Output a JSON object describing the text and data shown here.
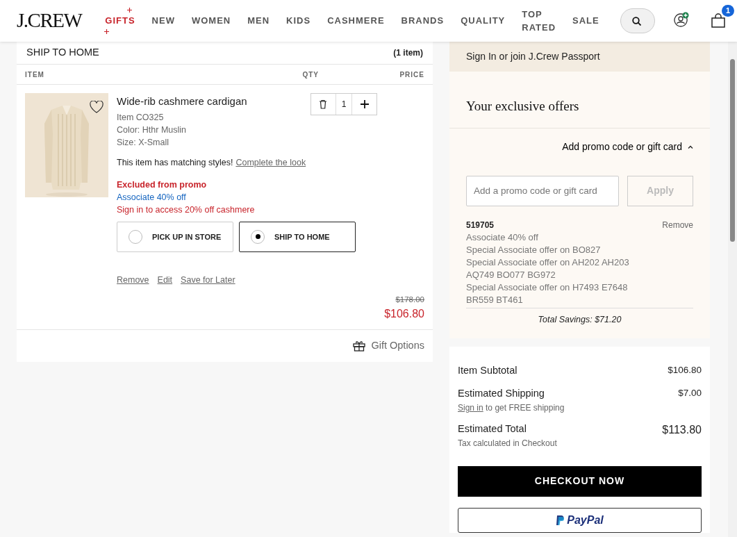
{
  "header": {
    "logo": "J.CREW",
    "cart_count": "1",
    "nav": [
      {
        "label": "GIFTS",
        "kind": "featured"
      },
      {
        "label": "NEW",
        "kind": "plain"
      },
      {
        "label": "WOMEN",
        "kind": "plain"
      },
      {
        "label": "MEN",
        "kind": "plain"
      },
      {
        "label": "KIDS",
        "kind": "plain"
      },
      {
        "label": "CASHMERE",
        "kind": "plain"
      },
      {
        "label": "BRANDS",
        "kind": "plain"
      },
      {
        "label": "QUALITY",
        "kind": "plain"
      },
      {
        "label": "TOP RATED",
        "kind": "plain"
      },
      {
        "label": "SALE",
        "kind": "plain"
      }
    ]
  },
  "shipment": {
    "title": "SHIP TO HOME",
    "count": "(1 item)",
    "columns": [
      "ITEM",
      "QTY",
      "PRICE"
    ],
    "item": {
      "name": "Wide-rib cashmere cardigan",
      "details": [
        "Item CO325",
        "Color: Hthr Muslin",
        "Size: X-Small"
      ],
      "matching_text": "This item has matching styles!",
      "matching_link": "Complete the look",
      "promos": [
        {
          "text": "Excluded from promo",
          "kind": "excluded"
        },
        {
          "text": "Associate 40% off",
          "kind": "associate"
        },
        {
          "text": "Sign in to access 20% off cashmere",
          "kind": "notice"
        }
      ],
      "quantity": "1",
      "delivery_options": [
        {
          "label": "PICK UP IN STORE",
          "selected": false
        },
        {
          "label": "SHIP TO HOME",
          "selected": true
        }
      ],
      "actions": [
        "Remove",
        "Edit",
        "Save for Later"
      ],
      "original_price": "$178.00",
      "price": "$106.80"
    },
    "gift_options": "Gift Options"
  },
  "passport": {
    "sign_in": "Sign In",
    "or": "or",
    "join": "join",
    "program": "J.Crew Passport"
  },
  "offers": {
    "title": "Your exclusive offers",
    "promo_toggle": {
      "label": "Add promo code or gift card",
      "expanded": true
    },
    "promo_field": {
      "placeholder": "Add a promo code or gift card"
    },
    "apply": {
      "label": "Apply",
      "disabled": true
    },
    "applied": {
      "code": "519705",
      "remove": "Remove",
      "lines": [
        "Associate 40% off",
        "Special Associate offer on BO827",
        "Special Associate offer on AH202 AH203 AQ749 BO077 BG972",
        "Special Associate offer on H7493 E7648 BR559 BT461"
      ]
    },
    "total_savings": "Total Savings: $71.20"
  },
  "summary": {
    "rows": [
      {
        "label": "Item Subtotal",
        "value": "$106.80",
        "kind": "plain"
      },
      {
        "label": "Estimated Shipping",
        "value": "$7.00",
        "kind": "link_note",
        "note_link": "Sign in",
        "note": "to get FREE shipping"
      },
      {
        "label": "Estimated Total",
        "value": "$113.80",
        "kind": "note",
        "note": "Tax calculated in Checkout"
      }
    ],
    "checkout": "CHECKOUT NOW",
    "paypal": "PayPal"
  }
}
